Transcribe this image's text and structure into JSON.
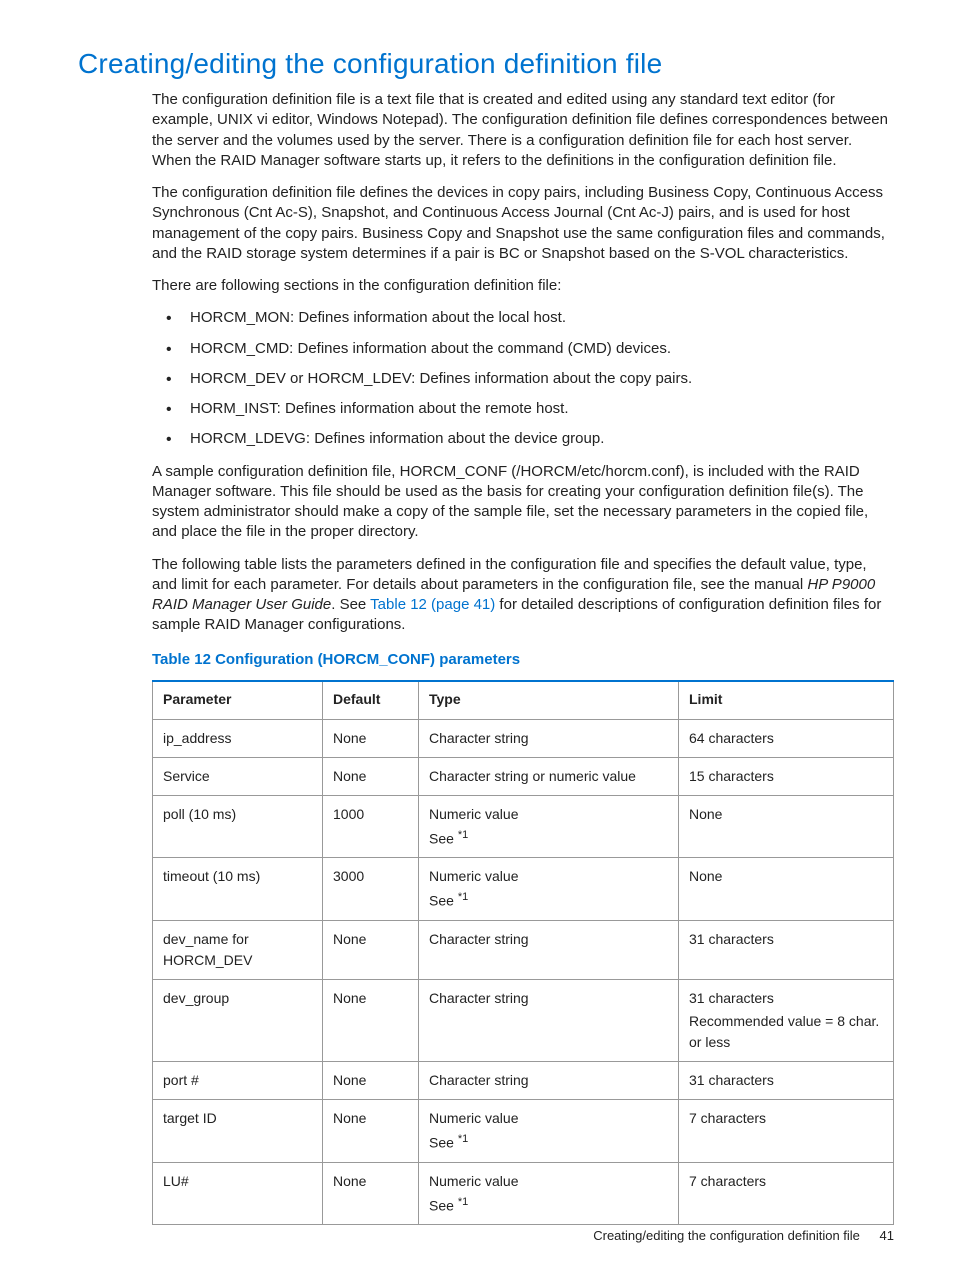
{
  "heading": "Creating/editing the configuration definition file",
  "paras": {
    "p1": "The configuration definition file is a text file that is created and edited using any standard text editor (for example, UNIX vi editor, Windows Notepad). The configuration definition file defines correspondences between the server and the volumes used by the server. There is a configuration definition file for each host server. When the RAID Manager software starts up, it refers to the definitions in the configuration definition file.",
    "p2": "The configuration definition file defines the devices in copy pairs, including Business Copy, Continuous Access Synchronous (Cnt Ac-S), Snapshot, and Continuous Access Journal (Cnt Ac-J) pairs, and is used for host management of the copy pairs. Business Copy and Snapshot use the same configuration files and commands, and the RAID storage system determines if a pair is BC or Snapshot based on the S-VOL characteristics.",
    "p3": "There are following sections in the configuration definition file:",
    "p4": "A sample configuration definition file, HORCM_CONF (/HORCM/etc/horcm.conf), is included with the RAID Manager software. This file should be used as the basis for creating your configuration definition file(s). The system administrator should make a copy of the sample file, set the necessary parameters in the copied file, and place the file in the proper directory.",
    "p5_a": "The following table lists the parameters defined in the configuration file and specifies the default value, type, and limit for each parameter. For details about parameters in the configuration file, see the manual ",
    "p5_i": "HP P9000 RAID Manager User Guide",
    "p5_b": ". See ",
    "p5_link": "Table 12 (page 41)",
    "p5_c": " for detailed descriptions of configuration definition files for sample RAID Manager configurations."
  },
  "bullets": [
    "HORCM_MON: Defines information about the local host.",
    "HORCM_CMD: Defines information about the command (CMD) devices.",
    "HORCM_DEV or HORCM_LDEV: Defines information about the copy pairs.",
    "HORM_INST: Defines information about the remote host.",
    "HORCM_LDEVG: Defines information about the device group."
  ],
  "table_caption": "Table 12 Configuration (HORCM_CONF) parameters",
  "table": {
    "headers": [
      "Parameter",
      "Default",
      "Type",
      "Limit"
    ],
    "rows": [
      {
        "param": "ip_address",
        "default": "None",
        "type": "Character string",
        "type2": "",
        "limit": "64 characters",
        "limit2": ""
      },
      {
        "param": "Service",
        "default": "None",
        "type": "Character string or numeric value",
        "type2": "",
        "limit": "15 characters",
        "limit2": ""
      },
      {
        "param": "poll (10 ms)",
        "default": "1000",
        "type": "Numeric value",
        "type2": "See *1",
        "limit": "None",
        "limit2": ""
      },
      {
        "param": "timeout (10 ms)",
        "default": "3000",
        "type": "Numeric value",
        "type2": "See *1",
        "limit": "None",
        "limit2": ""
      },
      {
        "param": "dev_name for HORCM_DEV",
        "default": "None",
        "type": "Character string",
        "type2": "",
        "limit": "31 characters",
        "limit2": ""
      },
      {
        "param": "dev_group",
        "default": "None",
        "type": "Character string",
        "type2": "",
        "limit": "31 characters",
        "limit2": "Recommended value = 8 char. or less"
      },
      {
        "param": "port #",
        "default": "None",
        "type": "Character string",
        "type2": "",
        "limit": "31 characters",
        "limit2": ""
      },
      {
        "param": "target ID",
        "default": "None",
        "type": "Numeric value",
        "type2": "See *1",
        "limit": "7 characters",
        "limit2": ""
      },
      {
        "param": "LU#",
        "default": "None",
        "type": "Numeric value",
        "type2": "See *1",
        "limit": "7 characters",
        "limit2": ""
      }
    ]
  },
  "footer": {
    "text": "Creating/editing the configuration definition file",
    "page": "41"
  }
}
